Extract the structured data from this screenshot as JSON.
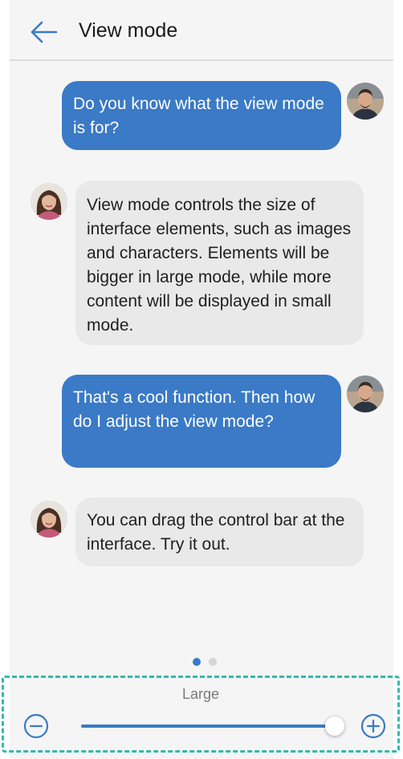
{
  "header": {
    "title": "View mode",
    "back_icon": "arrow-left-icon"
  },
  "messages": [
    {
      "sender": "male-avatar",
      "side": "right",
      "text": "Do you know what the view mode is for?"
    },
    {
      "sender": "female-avatar",
      "side": "left",
      "text": "View mode controls the size of interface elements, such as images and characters. Elements will be bigger in large mode, while more content will be displayed in small mode."
    },
    {
      "sender": "male-avatar",
      "side": "right",
      "text": "That's a cool function. Then how do I adjust the view mode?"
    },
    {
      "sender": "female-avatar",
      "side": "left",
      "text": "You can drag the control bar at the interface. Try it out."
    }
  ],
  "pager": {
    "current": 1,
    "total": 2
  },
  "view_mode_control": {
    "label": "Large",
    "value_fraction": 1.0,
    "minus_icon": "minus-circle-icon",
    "plus_icon": "plus-circle-icon"
  },
  "colors": {
    "accent": "#3a7ac6",
    "incoming_bubble": "#e9e9e9",
    "background": "#f5f5f5",
    "highlight_border": "#35b8ae"
  }
}
